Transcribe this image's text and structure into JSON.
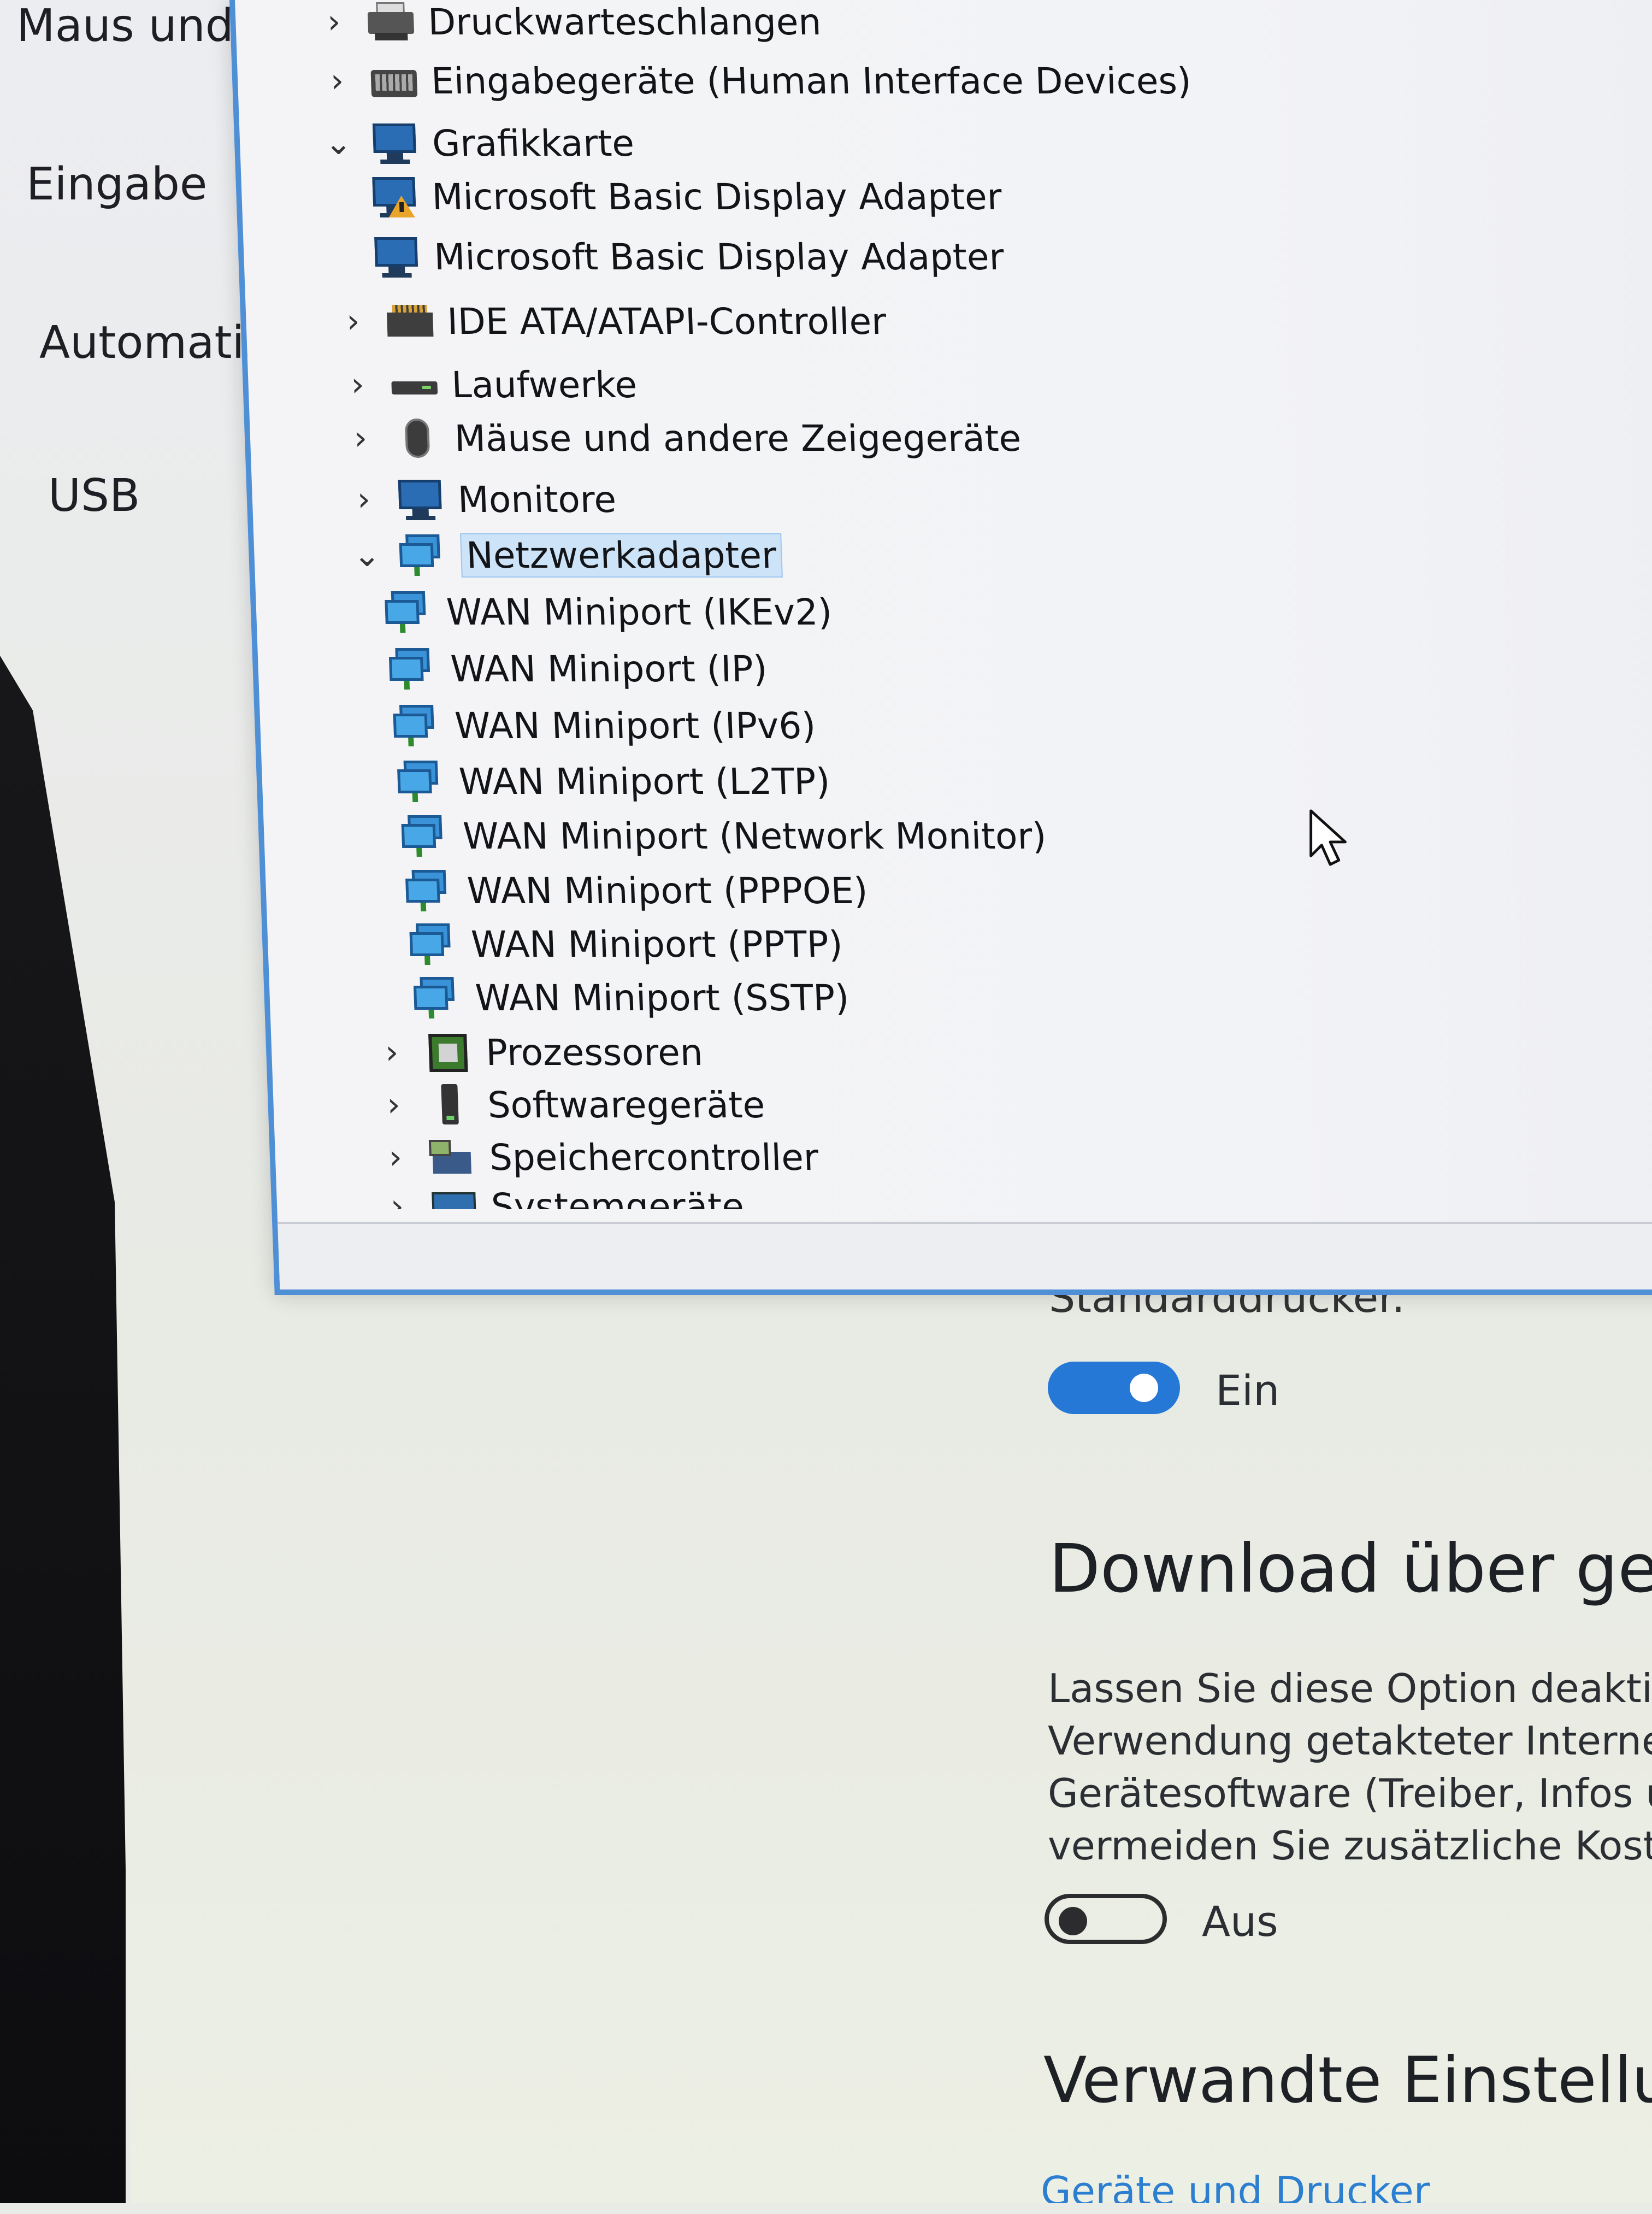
{
  "settings": {
    "nav": {
      "mouse_label": "Maus und",
      "input_label": "Eingabe",
      "autoplay_label": "Automatis",
      "usb_label": "USB"
    },
    "default_printer_label": "Standarddrucker.",
    "default_printer_toggle": {
      "state": "on",
      "label": "Ein"
    },
    "metered_heading": "Download über geta",
    "metered_description": [
      "Lassen Sie diese Option deaktiv",
      "Verwendung getakteter Internet",
      "Gerätesoftware (Treiber, Infos ur",
      "vermeiden Sie zusätzliche Koste"
    ],
    "metered_toggle": {
      "state": "off",
      "label": "Aus"
    },
    "related_heading": "Verwandte Einstellun",
    "related_link": "Geräte und Drucker"
  },
  "device_manager": {
    "tree": [
      {
        "label": "Druckwarteschlangen",
        "expanded": false,
        "icon": "printer-icon",
        "level": 0
      },
      {
        "label": "Eingabegeräte (Human Interface Devices)",
        "expanded": false,
        "icon": "keyboard-icon",
        "level": 0
      },
      {
        "label": "Grafikkarte",
        "expanded": true,
        "icon": "monitor-icon",
        "level": 0
      },
      {
        "label": "Microsoft Basic Display Adapter",
        "icon": "display-adapter-warning-icon",
        "level": 1,
        "warning": true
      },
      {
        "label": "Microsoft Basic Display Adapter",
        "icon": "display-adapter-icon",
        "level": 1
      },
      {
        "label": "IDE ATA/ATAPI-Controller",
        "expanded": false,
        "icon": "ide-controller-icon",
        "level": 0
      },
      {
        "label": "Laufwerke",
        "expanded": false,
        "icon": "disk-drive-icon",
        "level": 0
      },
      {
        "label": "Mäuse und andere Zeigegeräte",
        "expanded": false,
        "icon": "mouse-icon",
        "level": 0
      },
      {
        "label": "Monitore",
        "expanded": false,
        "icon": "monitor-icon",
        "level": 0
      },
      {
        "label": "Netzwerkadapter",
        "expanded": true,
        "icon": "network-adapter-icon",
        "level": 0,
        "selected": true
      },
      {
        "label": "WAN Miniport (IKEv2)",
        "icon": "network-adapter-icon",
        "level": 1
      },
      {
        "label": "WAN Miniport (IP)",
        "icon": "network-adapter-icon",
        "level": 1
      },
      {
        "label": "WAN Miniport (IPv6)",
        "icon": "network-adapter-icon",
        "level": 1
      },
      {
        "label": "WAN Miniport (L2TP)",
        "icon": "network-adapter-icon",
        "level": 1
      },
      {
        "label": "WAN Miniport (Network Monitor)",
        "icon": "network-adapter-icon",
        "level": 1
      },
      {
        "label": "WAN Miniport (PPPOE)",
        "icon": "network-adapter-icon",
        "level": 1
      },
      {
        "label": "WAN Miniport (PPTP)",
        "icon": "network-adapter-icon",
        "level": 1
      },
      {
        "label": "WAN Miniport (SSTP)",
        "icon": "network-adapter-icon",
        "level": 1
      },
      {
        "label": "Prozessoren",
        "expanded": false,
        "icon": "processor-icon",
        "level": 0
      },
      {
        "label": "Softwaregeräte",
        "expanded": false,
        "icon": "software-device-icon",
        "level": 0
      },
      {
        "label": "Speichercontroller",
        "expanded": false,
        "icon": "storage-controller-icon",
        "level": 0
      },
      {
        "label": "Systemgeräte",
        "expanded": false,
        "icon": "system-device-icon",
        "level": 0
      }
    ]
  },
  "colors": {
    "accent": "#2678d7",
    "window_border": "#4f8fd6",
    "selection": "#cde3f8",
    "link": "#2c7fd0"
  }
}
